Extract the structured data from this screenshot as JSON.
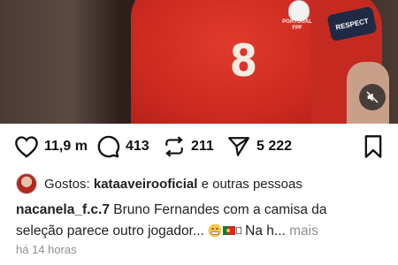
{
  "post": {
    "armband_text": "RESPECT",
    "shirt_number": "8",
    "crest_text_line1": "PORTUGAL",
    "crest_text_line2": "FPF"
  },
  "actions": {
    "likes": "11,9 m",
    "comments": "413",
    "reposts": "211",
    "shares": "5 222"
  },
  "likes_row": {
    "prefix": "Gostos:",
    "user": "kataaveirooficial",
    "suffix": "e outras pessoas"
  },
  "caption": {
    "username": "nacanela_f.c.7",
    "text1": " Bruno Fernandes com a camisa da",
    "text2": "seleção parece outro jogador...",
    "text3": "Na h...",
    "more": "mais"
  },
  "timestamp": "há 14 horas",
  "colors": {
    "jersey_red": "#cc2a20",
    "text": "#111111",
    "secondary": "#8e8e8e"
  }
}
